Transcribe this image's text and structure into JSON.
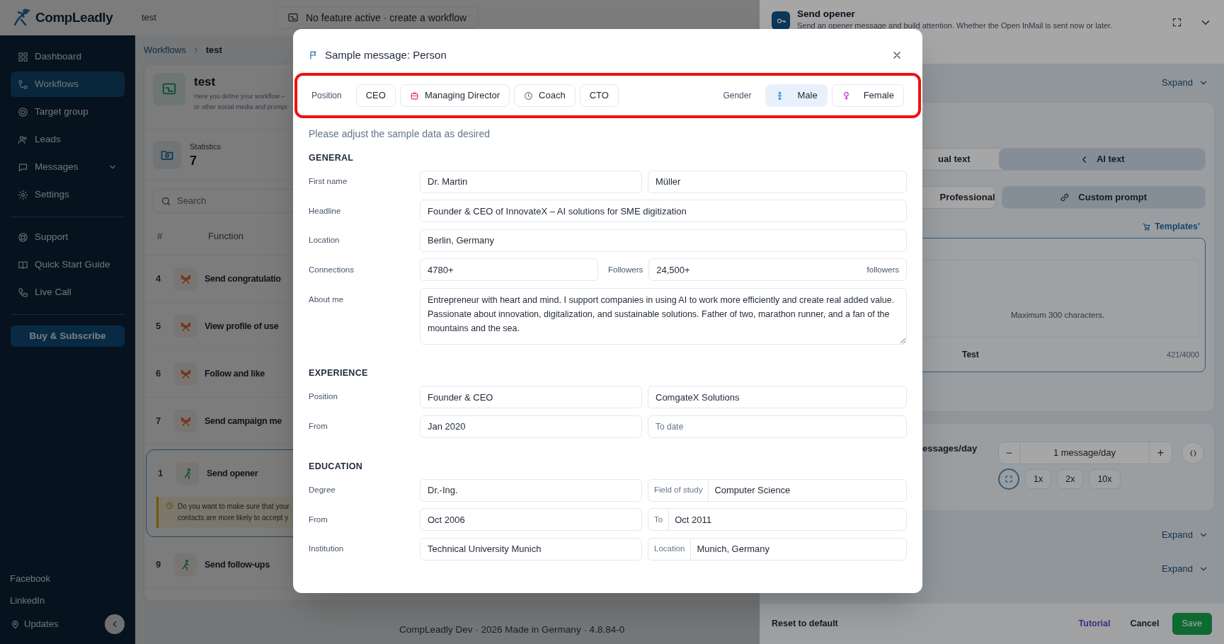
{
  "topbar": {
    "logo": "CompLeadly",
    "project": "test",
    "feature_status": "No feature active · create a workflow"
  },
  "sidebar": {
    "items": [
      {
        "label": "Dashboard",
        "kind": "dashboard",
        "selected": false,
        "has_submenu": false
      },
      {
        "label": "Workflows",
        "kind": "workflows",
        "selected": true,
        "has_submenu": false
      },
      {
        "label": "Target group",
        "kind": "target",
        "selected": false,
        "has_submenu": false
      },
      {
        "label": "Leads",
        "kind": "leads",
        "selected": false,
        "has_submenu": false
      },
      {
        "label": "Messages",
        "kind": "messages",
        "selected": false,
        "has_submenu": true
      },
      {
        "label": "Settings",
        "kind": "settings",
        "selected": false,
        "has_submenu": false
      }
    ],
    "help_items": [
      {
        "label": "Support",
        "kind": "support"
      },
      {
        "label": "Quick Start Guide",
        "kind": "guide"
      },
      {
        "label": "Live Call",
        "kind": "call"
      }
    ],
    "buy_button": "Buy & Subscribe",
    "footer_links": [
      "Facebook",
      "LinkedIn"
    ],
    "updates": "Updates"
  },
  "workspace": {
    "breadcrumb": [
      "Workflows",
      "test"
    ],
    "title": "test",
    "description": [
      "Here you define your workflow –",
      "or other social media and prompt"
    ],
    "statistics": {
      "label": "Statistics",
      "value": "7"
    },
    "search_placeholder": "Search",
    "columns": [
      "#",
      "Function"
    ],
    "rows": [
      {
        "number": "4",
        "function": "Send congratulatio",
        "kind": "action",
        "selected": false
      },
      {
        "number": "5",
        "function": "View profile of use",
        "kind": "action",
        "selected": false
      },
      {
        "number": "6",
        "function": "Follow and like",
        "kind": "action",
        "selected": false
      },
      {
        "number": "7",
        "function": "Send campaign me",
        "kind": "action",
        "selected": false
      },
      {
        "number": "1",
        "function": "Send opener",
        "kind": "message",
        "selected": true,
        "warning": [
          "Do you want to make sure that your",
          "contacts are more likely to accept y"
        ]
      },
      {
        "number": "9",
        "function": "Send follow-ups",
        "kind": "message",
        "selected": false
      }
    ],
    "footer": "CompLeadly Dev · 2026 Made in Germany · 4.8.84-0"
  },
  "side_panel": {
    "title": "Send opener",
    "subtitle": "Send an opener message and build attention. Whether the Open InMail is sent now or later.",
    "section_toggle": "Sxpand",
    "text_modes": [
      {
        "label": "ual text",
        "selected": false
      },
      {
        "label": "AI text",
        "selected": true
      }
    ],
    "styles": [
      {
        "label": "Professional",
        "selected": false
      },
      {
        "label": "Custom prompt",
        "selected": true
      }
    ],
    "templates": "Templates'",
    "hint": "Maximum 300 characters.",
    "signature": "Test",
    "counter": "421/4000",
    "rate_label": "essages/day",
    "minus": "−",
    "rate_value": "1 message/day",
    "plus": "+",
    "multipliers": [
      {
        "label": "1x",
        "selected": false
      },
      {
        "label": "2x",
        "selected": false
      },
      {
        "label": "10x",
        "selected": false
      }
    ],
    "expand_labels": [
      "Expand",
      "Expand"
    ],
    "reset": "Reset to default",
    "tutorial": "Tutorial",
    "cancel": "Cancel",
    "save": "Save"
  },
  "modal": {
    "title": "Sample message: Person",
    "position_label": "Position",
    "positions": [
      {
        "label": "CEO",
        "selected": false
      },
      {
        "label": "Managing Director",
        "kind": "badge",
        "selected": false
      },
      {
        "label": "Coach",
        "kind": "clock",
        "selected": false
      },
      {
        "label": "CTO",
        "selected": false
      }
    ],
    "gender_label": "Gender",
    "genders": [
      {
        "label": "Male",
        "kind": "male",
        "selected": true
      },
      {
        "label": "Female",
        "kind": "female",
        "selected": false
      }
    ],
    "intro": "Please adjust the sample data as desired",
    "sections": [
      {
        "heading": "GENERAL",
        "rows": [
          {
            "label": "First name",
            "fields": [
              {
                "value": "Dr. Martin"
              },
              {
                "value": "Müller"
              }
            ]
          },
          {
            "label": "Headline",
            "fields": [
              {
                "value": "Founder & CEO of InnovateX – AI solutions for SME digitization"
              }
            ]
          },
          {
            "label": "Location",
            "fields": [
              {
                "value": "Berlin, Germany"
              }
            ]
          },
          {
            "label": "Connections",
            "fields": [
              {
                "value": "4780+"
              },
              {
                "outer_label": "Followers",
                "value": "24,500+",
                "suffix": "followers"
              }
            ]
          },
          {
            "label": "About me",
            "kind": "textarea",
            "fields": [
              {
                "value": "Entrepreneur with heart and mind. I support companies in using AI to work more efficiently and create real added value. Passionate about innovation, digitalization, and sustainable solutions. Father of two, marathon runner, and a fan of the mountains and the sea."
              }
            ]
          }
        ]
      },
      {
        "heading": "EXPERIENCE",
        "rows": [
          {
            "label": "Position",
            "fields": [
              {
                "value": "Founder & CEO"
              },
              {
                "value": "ComgateX Solutions"
              }
            ]
          },
          {
            "label": "From",
            "fields": [
              {
                "value": "Jan 2020"
              },
              {
                "placeholder": "To date"
              }
            ]
          }
        ]
      },
      {
        "heading": "EDUCATION",
        "rows": [
          {
            "label": "Degree",
            "fields": [
              {
                "value": "Dr.-Ing."
              },
              {
                "prefix": "Field of study",
                "value": "Computer Science"
              }
            ]
          },
          {
            "label": "From",
            "fields": [
              {
                "value": "Oct 2006"
              },
              {
                "prefix": "To",
                "value": "Oct 2011"
              }
            ]
          },
          {
            "label": "Institution",
            "fields": [
              {
                "value": "Technical University Munich"
              },
              {
                "prefix": "Location",
                "value": "Munich, Germany"
              }
            ]
          }
        ]
      }
    ]
  }
}
